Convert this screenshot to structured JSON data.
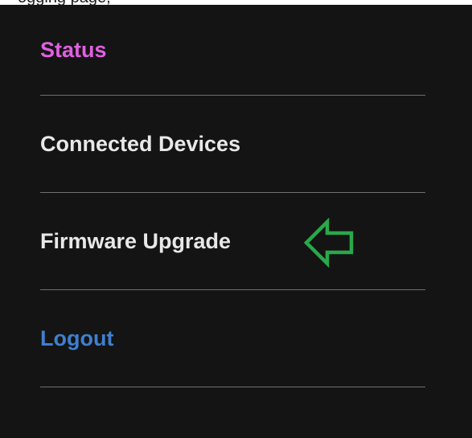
{
  "top_strip": {
    "text": "ogging                                   page,"
  },
  "menu": {
    "items": [
      {
        "label": "Status",
        "color": "#e060e0"
      },
      {
        "label": "Connected Devices",
        "color": "#e8e8e8"
      },
      {
        "label": "Firmware Upgrade",
        "color": "#e8e8e8"
      },
      {
        "label": "Logout",
        "color": "#3f7fcf"
      }
    ]
  },
  "annotation": {
    "icon": "left-arrow-outline-icon",
    "color": "#2aa84a"
  }
}
